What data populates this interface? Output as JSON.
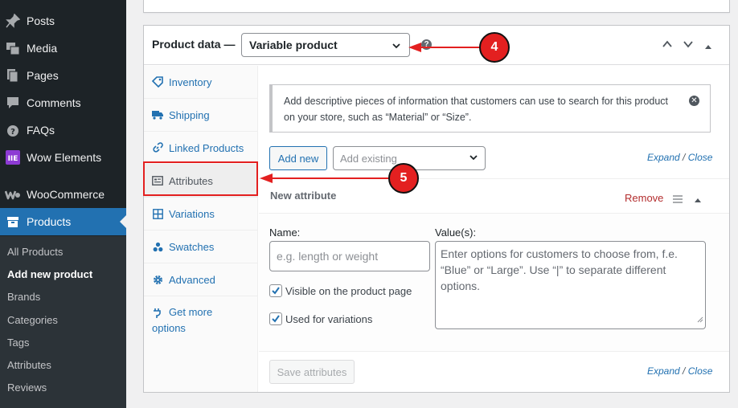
{
  "sidebar": {
    "items": [
      {
        "label": "Posts",
        "icon": "pin-icon"
      },
      {
        "label": "Media",
        "icon": "media-icon"
      },
      {
        "label": "Pages",
        "icon": "pages-icon"
      },
      {
        "label": "Comments",
        "icon": "comments-icon"
      },
      {
        "label": "FAQs",
        "icon": "faq-icon"
      },
      {
        "label": "Wow Elements",
        "icon": "wow-elements-icon"
      },
      {
        "label": "WooCommerce",
        "icon": "woocommerce-icon"
      },
      {
        "label": "Products",
        "icon": "products-icon"
      }
    ],
    "submenu": [
      "All Products",
      "Add new product",
      "Brands",
      "Categories",
      "Tags",
      "Attributes",
      "Reviews"
    ]
  },
  "product_data": {
    "title": "Product data —",
    "type_value": "Variable product"
  },
  "tabs": [
    {
      "label": "Inventory",
      "icon": "inventory-icon"
    },
    {
      "label": "Shipping",
      "icon": "truck-icon"
    },
    {
      "label": "Linked Products",
      "icon": "link-icon"
    },
    {
      "label": "Attributes",
      "icon": "attributes-icon"
    },
    {
      "label": "Variations",
      "icon": "grid-icon"
    },
    {
      "label": "Swatches",
      "icon": "swatches-icon"
    },
    {
      "label": "Advanced",
      "icon": "gear-icon"
    },
    {
      "label_line1": "Get more",
      "label_line2": "options",
      "icon": "plugin-icon"
    }
  ],
  "notice": {
    "text": "Add descriptive pieces of information that customers can use to search for this product on your store, such as “Material” or “Size”."
  },
  "actions": {
    "add_new": "Add new",
    "add_existing_placeholder": "Add existing",
    "expand": "Expand",
    "separator": "/",
    "close": "Close"
  },
  "attribute": {
    "title": "New attribute",
    "remove": "Remove",
    "name_label": "Name:",
    "name_placeholder": "e.g. length or weight",
    "values_label": "Value(s):",
    "values_placeholder": "Enter options for customers to choose from, f.e. “Blue” or “Large”. Use “|” to separate different options.",
    "visible_label": "Visible on the product page",
    "visible_checked": true,
    "variations_label": "Used for variations",
    "variations_checked": true
  },
  "save_attributes": "Save attributes",
  "annotations": {
    "step4": "4",
    "step5": "5",
    "color": "#e32020"
  }
}
